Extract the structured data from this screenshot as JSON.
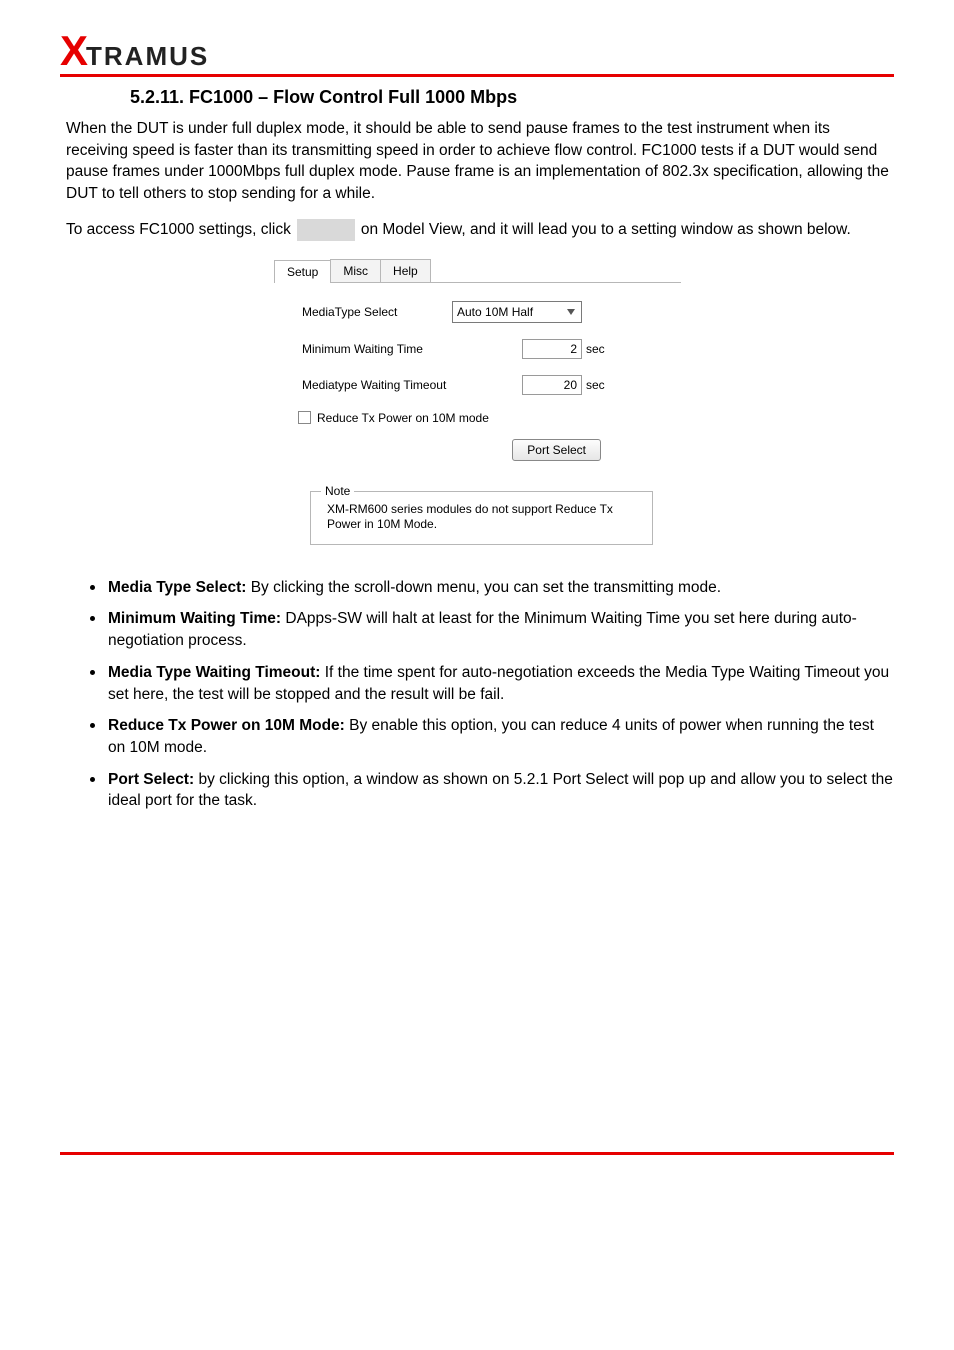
{
  "logo": {
    "x": "X",
    "rest": "TRAMUS"
  },
  "section_title": "5.2.11. FC1000 – Flow Control Full 1000 Mbps",
  "para1": "When the DUT is under full duplex mode, it should be able to send pause frames to the test instrument when its receiving speed is faster than its transmitting speed in order to achieve flow control. FC1000 tests if a DUT would send pause frames under 1000Mbps full duplex mode. Pause frame is an implementation of 802.3x specification, allowing the DUT to tell others to stop sending for a while.",
  "para2_pre": "To access FC1000 settings, click",
  "para2_post": "on Model View, and it will lead you to a setting window as shown below.",
  "panel": {
    "tabs": {
      "setup": "Setup",
      "misc": "Misc",
      "help": "Help"
    },
    "media_label": "MediaType Select",
    "media_value": "Auto 10M Half",
    "min_wait_label": "Minimum Waiting Time",
    "min_wait_value": "2",
    "timeout_label": "Mediatype Waiting Timeout",
    "timeout_value": "20",
    "sec": "sec",
    "reduce_label": "Reduce Tx Power on 10M mode",
    "port_btn": "Port Select",
    "note_legend": "Note",
    "note_text": "XM-RM600 series modules do not support Reduce Tx Power in 10M Mode."
  },
  "bullets": {
    "b1_bold": "Media Type Select: ",
    "b1_rest": "By clicking the scroll-down menu, you can set the transmitting mode.",
    "b2_bold": "Minimum Waiting Time: ",
    "b2_rest": "DApps-SW will halt at least for the Minimum Waiting Time you set here during auto-negotiation process.",
    "b3_bold": "Media Type Waiting Timeout: ",
    "b3_rest": "If the time spent for auto-negotiation exceeds the Media Type Waiting Timeout you set here, the test will be stopped and the result will be fail.",
    "b4_bold": "Reduce Tx Power on 10M Mode: ",
    "b4_rest": "By enable this option, you can reduce 4 units of power when running the test on 10M mode.",
    "b5_bold": "Port Select: ",
    "b5_rest": "by clicking this option, a window as shown on 5.2.1 Port Select will pop up and allow you to select the ideal port for the task."
  },
  "footer": {
    "left": "",
    "right": ""
  }
}
